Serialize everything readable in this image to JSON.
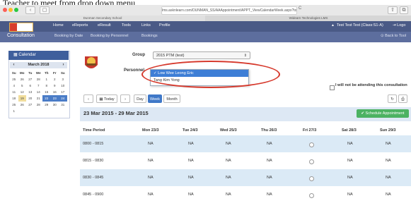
{
  "caption": "Teacher to meet from drop down menu",
  "browser": {
    "url": "lms.asknlearn.com/DUNMAN_SS/AAAppointment/APPT_ViewCalendarWeek.aspx?tool=",
    "tabs": [
      "Dunman Secondary School",
      "Widearn Technologies LMS"
    ],
    "back": "‹",
    "sidebar_toggle": "▢",
    "reload": "C",
    "share": "⇧",
    "extend": "⧉"
  },
  "topnav": {
    "items": [
      "Home",
      "eReports",
      "eResult",
      "Tools",
      "Links",
      "Profile"
    ],
    "user": "Test Test Test (Class:S1-A)",
    "logout": "Logo"
  },
  "subnav": {
    "title": "Consultation",
    "items": [
      "Booking by Date",
      "Booking by Personnel",
      "Bookings"
    ],
    "back": "Back to Tool"
  },
  "calendar": {
    "header": "Calendar",
    "month": "March 2018",
    "prev": "‹",
    "next": "›",
    "days": [
      "Su",
      "Mo",
      "Tu",
      "We",
      "Th",
      "Fr",
      "Sa"
    ],
    "weeks": [
      [
        "25",
        "26",
        "27",
        "28",
        "1",
        "2",
        "3"
      ],
      [
        "4",
        "5",
        "6",
        "7",
        "8",
        "9",
        "10"
      ],
      [
        "11",
        "12",
        "13",
        "14",
        "15",
        "16",
        "17"
      ],
      [
        "18",
        "19",
        "20",
        "21",
        "22",
        "23",
        "24"
      ],
      [
        "25",
        "26",
        "27",
        "28",
        "29",
        "30",
        "31"
      ],
      [
        "1",
        "",
        "",
        "",
        "",
        "",
        ""
      ]
    ]
  },
  "form": {
    "group_label": "Group",
    "group_value": "2015 PTM (test)",
    "personnel_label": "Personnel",
    "options": [
      "✓ Low Wee Leong Eric",
      "Tang Kim Yong"
    ],
    "not_attending": "I will not be attending this consultation"
  },
  "toolbar": {
    "prev": "‹",
    "today": "Today",
    "next": "›",
    "day": "Day",
    "week": "Week",
    "month": "Month",
    "refresh": "↻",
    "print": "⎙"
  },
  "week_range": "23 Mar 2015 - 29 Mar 2015",
  "schedule_btn": "✔ Schedule Appointment",
  "table": {
    "headers": [
      "Time Period",
      "Mon 23/3",
      "Tue 24/3",
      "Wed 25/3",
      "Thu 26/3",
      "Fri 27/3",
      "Sat 28/3",
      "Sun 29/3"
    ],
    "rows": [
      [
        "0800 - 0815",
        "NA",
        "NA",
        "NA",
        "NA",
        "",
        "NA",
        "NA"
      ],
      [
        "0815 - 0830",
        "NA",
        "NA",
        "NA",
        "NA",
        "",
        "NA",
        "NA"
      ],
      [
        "0830 - 0845",
        "NA",
        "NA",
        "NA",
        "NA",
        "",
        "NA",
        "NA"
      ],
      [
        "0845 - 0900",
        "NA",
        "NA",
        "NA",
        "NA",
        "",
        "NA",
        "NA"
      ]
    ]
  }
}
